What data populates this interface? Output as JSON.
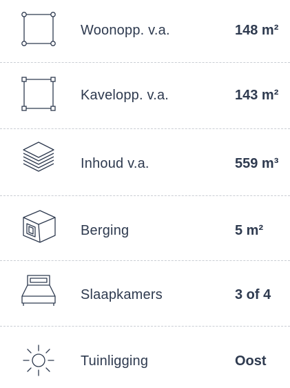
{
  "specs": [
    {
      "icon": "floor-area-icon",
      "label": "Woonopp. v.a.",
      "value": "148 m²"
    },
    {
      "icon": "plot-area-icon",
      "label": "Kavelopp. v.a.",
      "value": "143 m²"
    },
    {
      "icon": "layers-icon",
      "label": "Inhoud v.a.",
      "value": "559 m³"
    },
    {
      "icon": "box-icon",
      "label": "Berging",
      "value": "5 m²"
    },
    {
      "icon": "bed-icon",
      "label": "Slaapkamers",
      "value": "3 of 4"
    },
    {
      "icon": "sun-icon",
      "label": "Tuinligging",
      "value": "Oost"
    }
  ],
  "colors": {
    "text": "#2e3a4f",
    "divider": "#c9cdd3"
  }
}
